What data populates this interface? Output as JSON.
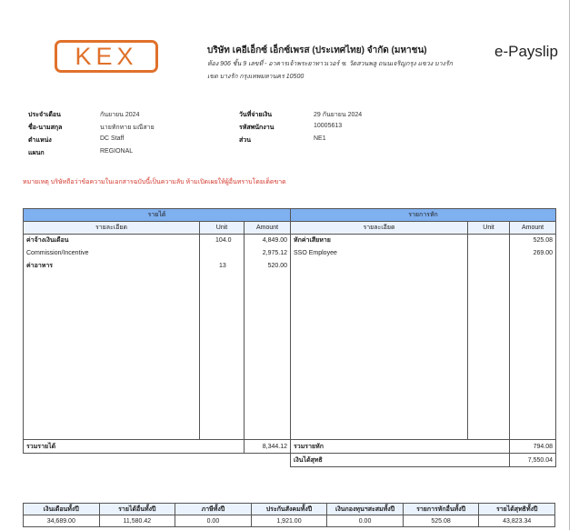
{
  "header": {
    "logo_text": "KEX",
    "company_name": "บริษัท เคอีเอ็กซ์ เอ็กซ์เพรส (ประเทศไทย) จำกัด (มหาชน)",
    "address_line1": "ห้อง 906 ชั้น 9 เลขที่ - อาคารเจ้าพระยาทาวเวอร์ ซ. วัดสวนพลู ถนนเจริญกรุง แขวง บางรัก",
    "address_line2": "เขต บางรัก กรุงเทพมหานคร 10500",
    "doc_title": "e-Payslip"
  },
  "info": {
    "period_label": "ประจำเดือน",
    "period_value": "กันยายน 2024",
    "name_label": "ชื่อ-นามสกุล",
    "name_value": "นายทักทาย มณีสาย",
    "position_label": "ตำแหน่ง",
    "position_value": "DC Staff",
    "dept_label": "แผนก",
    "dept_value": "REGIONAL",
    "paydate_label": "วันที่จ่ายเงิน",
    "paydate_value": "29 กันยายน 2024",
    "empid_label": "รหัสพนักงาน",
    "empid_value": "10005613",
    "section_label": "ส่วน",
    "section_value": "NE1"
  },
  "notice": "หมายเหตุ บริษัทถือว่าข้อความในเอกสารฉบับนี้เป็นความลับ ห้ามเปิดเผยให้ผู้อื่นทราบโดยเด็ดขาด",
  "income": {
    "title": "รายได้",
    "col_detail": "รายละเอียด",
    "col_unit": "Unit",
    "col_amount": "Amount",
    "rows": [
      {
        "detail": "ค่าจ้างเงินเดือน",
        "unit": "104.0",
        "amount": "4,849.00"
      },
      {
        "detail": "Commission/Incentive",
        "unit": "",
        "amount": "2,975.12"
      },
      {
        "detail": "ค่าอาหาร",
        "unit": "13",
        "amount": "520.00"
      }
    ],
    "total_label": "รวมรายได้",
    "total_value": "8,344.12"
  },
  "deduction": {
    "title": "รายการหัก",
    "col_detail": "รายละเอียด",
    "col_unit": "Unit",
    "col_amount": "Amount",
    "rows": [
      {
        "detail": "หักค่าเสียหาย",
        "unit": "",
        "amount": "525.08"
      },
      {
        "detail": "SSO Employee",
        "unit": "",
        "amount": "269.00"
      }
    ],
    "total_label": "รวมรายหัก",
    "total_value": "794.08",
    "net_label": "เงินได้สุทธิ",
    "net_value": "7,550.04"
  },
  "ytd": {
    "headers": [
      "เงินเดือนทั้งปี",
      "รายได้อื่นทั้งปี",
      "ภาษีทั้งปี",
      "ประกันสังคมทั้งปี",
      "เงินกองทุนฯสะสมทั้งปี",
      "รายการหักอื่นทั้งปี",
      "รายได้สุทธิทั้งปี"
    ],
    "values": [
      "34,689.00",
      "11,580.42",
      "0.00",
      "1,921.00",
      "0.00",
      "525.08",
      "43,823.34"
    ]
  }
}
